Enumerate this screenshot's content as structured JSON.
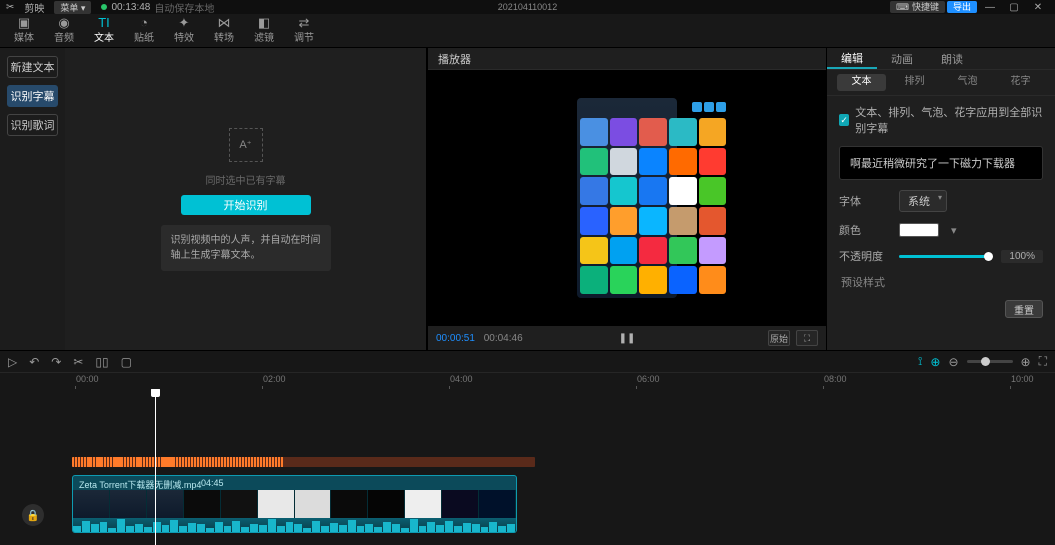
{
  "topbar": {
    "app_name": "剪映",
    "menu_label": "菜单",
    "timecode": "00:13:48",
    "autosave": "自动保存本地",
    "project_title": "202104110012",
    "quickkey": "快捷键",
    "login": "导出"
  },
  "toolbar": {
    "items": [
      "媒体",
      "音频",
      "文本",
      "贴纸",
      "特效",
      "转场",
      "滤镜",
      "调节"
    ],
    "active_index": 2
  },
  "sidebar": {
    "items": [
      "新建文本",
      "识别字幕",
      "识别歌词"
    ],
    "selected_index": 1
  },
  "recognize": {
    "placeholder_note": "同时选中已有字幕",
    "start": "开始识别",
    "desc": "识别视频中的人声，并自动在时间轴上生成字幕文本。"
  },
  "player": {
    "title": "播放器",
    "current": "00:00:51",
    "duration": "00:04:46",
    "ratio_label": "原始"
  },
  "inspector": {
    "tabs": [
      "编辑",
      "动画",
      "朗读"
    ],
    "tabs_active": 0,
    "subtabs": [
      "文本",
      "排列",
      "气泡",
      "花字"
    ],
    "subtabs_active": 0,
    "apply_all": "文本、排列、气泡、花字应用到全部识别字幕",
    "caption_text": "啊最近稍微研究了一下磁力下载器",
    "font_label": "字体",
    "font_value": "系统",
    "color_label": "颜色",
    "opacity_label": "不透明度",
    "opacity_value": "100%",
    "preset_label": "预设样式",
    "reset": "重置"
  },
  "timeline": {
    "ticks": [
      "00:00",
      "02:00",
      "04:00",
      "06:00",
      "08:00",
      "10:00"
    ],
    "clip_name": "Zeta Torrent下载器无删减.mp4",
    "clip_duration": "04:45"
  }
}
